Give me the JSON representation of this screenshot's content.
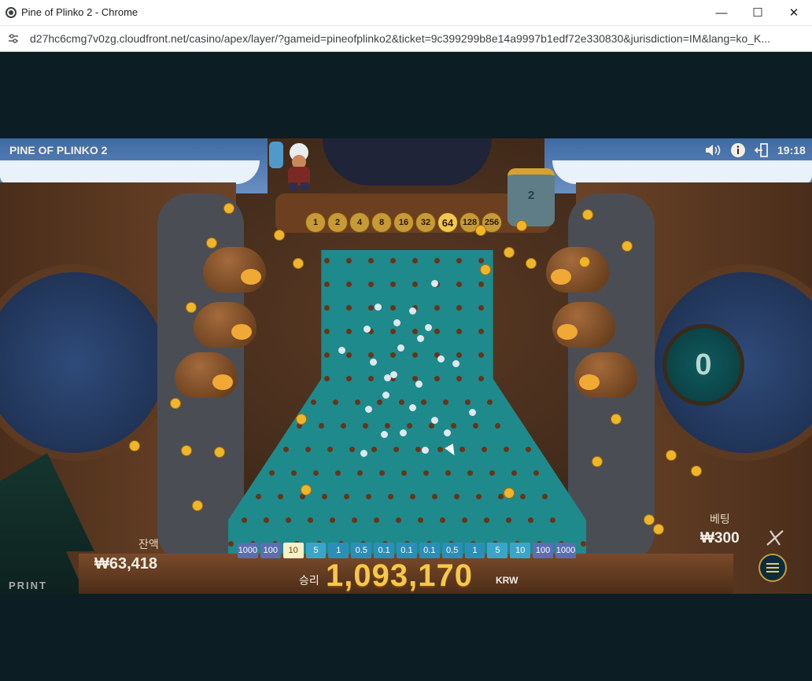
{
  "window": {
    "title": "Pine of Plinko 2 - Chrome",
    "minimize_label": "—",
    "maximize_label": "☐",
    "close_label": "✕"
  },
  "browser": {
    "url": "d27hc6cmg7v0zg.cloudfront.net/casino/apex/layer/?gameid=pineofplinko2&ticket=9c399299b8e14a9997b1edf72e330830&jurisdiction=IM&lang=ko_K..."
  },
  "game": {
    "title": "PINE OF PLINKO 2",
    "clock": "19:18",
    "multiplier_strip": [
      "1",
      "2",
      "4",
      "8",
      "16",
      "32",
      "64",
      "128",
      "256"
    ],
    "active_multiplier": "64",
    "chest_count": "2",
    "counter_value": "0",
    "buckets": [
      "1000",
      "100",
      "10",
      "5",
      "1",
      "0.5",
      "0.1",
      "0.1",
      "0.1",
      "0.5",
      "1",
      "5",
      "10",
      "100",
      "1000"
    ],
    "balance_label": "잔액",
    "balance_value": "₩63,418",
    "bet_label": "베팅",
    "bet_value": "₩300",
    "win_label": "승리",
    "win_value": "1,093,170",
    "win_currency": "KRW",
    "brand": "PRINT"
  },
  "colors": {
    "board": "#1e8a8c",
    "peg": "#6b3317",
    "coin": "#f0b629",
    "accent_gold": "#f3c74d"
  }
}
